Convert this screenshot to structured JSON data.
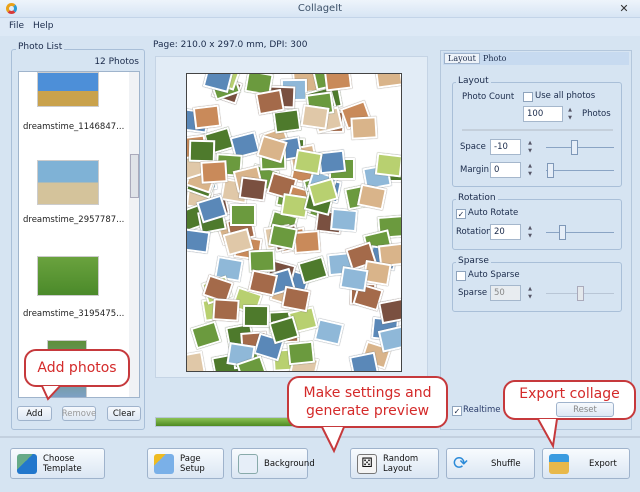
{
  "window": {
    "title": "CollageIt",
    "close_icon": "close-icon"
  },
  "menu": [
    "File",
    "Help"
  ],
  "photo_list": {
    "label": "Photo List",
    "count": "12 Photos",
    "items": [
      "dreamstime_1146847...",
      "dreamstime_2957787...",
      "dreamstime_3195475..."
    ],
    "buttons": {
      "add": "Add",
      "remove": "Remove",
      "clear": "Clear"
    }
  },
  "page_info": "Page: 210.0 x 297.0 mm, DPI: 300",
  "progress_percent": 100,
  "tabs": [
    "Layout",
    "Photo"
  ],
  "layout": {
    "label": "Layout",
    "photo_count_label": "Photo Count",
    "use_all_label": "Use all photos",
    "use_all": false,
    "photo_count": "100",
    "photos_unit": "Photos",
    "space_label": "Space",
    "space": "-10",
    "margin_label": "Margin",
    "margin": "0"
  },
  "rotation": {
    "label": "Rotation",
    "auto_rotate_label": "Auto Rotate",
    "auto_rotate": true,
    "rotation_label": "Rotation",
    "rotation": "20"
  },
  "sparse": {
    "label": "Sparse",
    "auto_sparse_label": "Auto Sparse",
    "auto_sparse": false,
    "sparse_label": "Sparse",
    "sparse": "50"
  },
  "realtime_preview": {
    "label": "Realtime Preview",
    "checked": true
  },
  "reset": "Reset",
  "bottom_buttons": {
    "choose_template": "Choose Template",
    "page_setup": "Page Setup",
    "background": "Background",
    "random_layout": "Random Layout",
    "shuffle": "Shuffle",
    "export": "Export"
  },
  "callouts": {
    "add": "Add photos",
    "settings": "Make settings and generate preview",
    "export": "Export collage"
  },
  "colors": {
    "accent_red": "#c6393c",
    "progress_green": "#5c9a2c",
    "panel_bg": "#d6e4f2"
  }
}
